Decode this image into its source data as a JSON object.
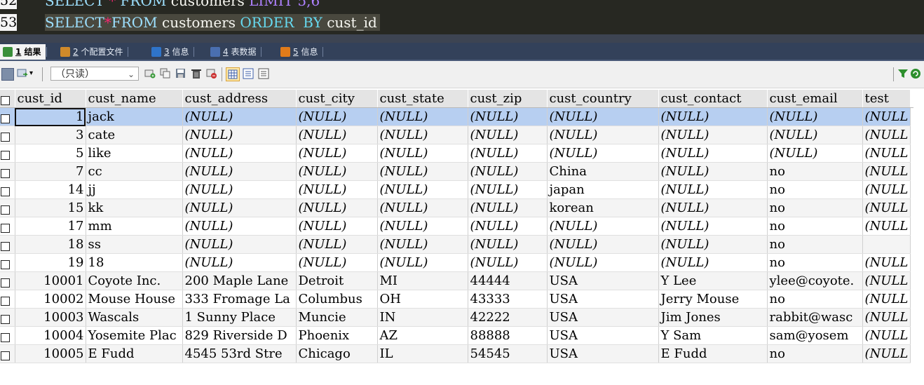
{
  "editor": {
    "lines": [
      {
        "number": "52",
        "tokens": [
          {
            "t": "SELECT ",
            "c": "kw"
          },
          {
            "t": "* ",
            "c": "op"
          },
          {
            "t": "FROM ",
            "c": "kw"
          },
          {
            "t": "customers ",
            "c": "id"
          },
          {
            "t": "LIMIT ",
            "c": "kwp"
          },
          {
            "t": "5,6",
            "c": "num"
          }
        ]
      },
      {
        "number": "53",
        "tokens": [
          {
            "t": "SELECT",
            "c": "kw"
          },
          {
            "t": "*",
            "c": "op"
          },
          {
            "t": "FROM ",
            "c": "kw"
          },
          {
            "t": "customers ",
            "c": "id"
          },
          {
            "t": "ORDER  BY ",
            "c": "kwd"
          },
          {
            "t": "cust_id",
            "c": "id"
          }
        ]
      }
    ]
  },
  "tabs": [
    {
      "num": "1",
      "label": "结果",
      "active": true,
      "icon": "result-grid-icon",
      "color": "#3a8f3a"
    },
    {
      "num": "2",
      "label": "个配置文件",
      "active": false,
      "icon": "profile-icon",
      "color": "#d08a2a"
    },
    {
      "num": "3",
      "label": "信息",
      "active": false,
      "icon": "info-icon",
      "color": "#2f74c9"
    },
    {
      "num": "4",
      "label": "表数据",
      "active": false,
      "icon": "table-data-icon",
      "color": "#4a6fb0"
    },
    {
      "num": "5",
      "label": "信息",
      "active": false,
      "icon": "info-chart-icon",
      "color": "#e07b1a"
    }
  ],
  "toolbar": {
    "readonly_label": "（只读）",
    "icons": [
      "grid-icon",
      "export-icon",
      "dropdown-icon",
      "insert-row-icon",
      "duplicate-row-icon",
      "save-icon",
      "delete-icon",
      "refresh-icon",
      "grid-view-icon",
      "form-view-icon",
      "text-view-icon",
      "filter-icon",
      "reset-filter-icon"
    ]
  },
  "grid": {
    "columns": [
      "cust_id",
      "cust_name",
      "cust_address",
      "cust_city",
      "cust_state",
      "cust_zip",
      "cust_country",
      "cust_contact",
      "cust_email",
      "test"
    ],
    "rows": [
      [
        "1",
        "jack",
        "(NULL)",
        "(NULL)",
        "(NULL)",
        "(NULL)",
        "(NULL)",
        "(NULL)",
        "(NULL)",
        "(NULL"
      ],
      [
        "3",
        "cate",
        "(NULL)",
        "(NULL)",
        "(NULL)",
        "(NULL)",
        "(NULL)",
        "(NULL)",
        "(NULL)",
        "(NULL"
      ],
      [
        "5",
        "like",
        "(NULL)",
        "(NULL)",
        "(NULL)",
        "(NULL)",
        "(NULL)",
        "(NULL)",
        "(NULL)",
        "(NULL"
      ],
      [
        "7",
        "cc",
        "(NULL)",
        "(NULL)",
        "(NULL)",
        "(NULL)",
        "China",
        "(NULL)",
        "no",
        "(NULL"
      ],
      [
        "14",
        "jj",
        "(NULL)",
        "(NULL)",
        "(NULL)",
        "(NULL)",
        "japan",
        "(NULL)",
        "no",
        "(NULL"
      ],
      [
        "15",
        "kk",
        "(NULL)",
        "(NULL)",
        "(NULL)",
        "(NULL)",
        "korean",
        "(NULL)",
        "no",
        "(NULL"
      ],
      [
        "17",
        "mm",
        "(NULL)",
        "(NULL)",
        "(NULL)",
        "(NULL)",
        "(NULL)",
        "(NULL)",
        "no",
        "(NULL"
      ],
      [
        "18",
        "ss",
        "(NULL)",
        "(NULL)",
        "(NULL)",
        "(NULL)",
        "(NULL)",
        "(NULL)",
        "no",
        ""
      ],
      [
        "19",
        "18",
        "(NULL)",
        "(NULL)",
        "(NULL)",
        "(NULL)",
        "(NULL)",
        "(NULL)",
        "no",
        "(NULL"
      ],
      [
        "10001",
        "Coyote Inc.",
        "200 Maple Lane",
        "Detroit",
        "MI",
        "44444",
        "USA",
        "Y Lee",
        "ylee@coyote.",
        "(NULL"
      ],
      [
        "10002",
        "Mouse House",
        "333 Fromage La",
        "Columbus",
        "OH",
        "43333",
        "USA",
        "Jerry Mouse",
        "no",
        "(NULL"
      ],
      [
        "10003",
        "Wascals",
        "1 Sunny Place",
        "Muncie",
        "IN",
        "42222",
        "USA",
        "Jim Jones",
        "rabbit@wasc",
        "(NULL"
      ],
      [
        "10004",
        "Yosemite Plac",
        "829 Riverside D",
        "Phoenix",
        "AZ",
        "88888",
        "USA",
        "Y Sam",
        "sam@yosem",
        "(NULL"
      ],
      [
        "10005",
        "E Fudd",
        "4545 53rd Stre",
        "Chicago",
        "IL",
        "54545",
        "USA",
        "E Fudd",
        "no",
        "(NULL"
      ]
    ],
    "selected_row": 0
  }
}
